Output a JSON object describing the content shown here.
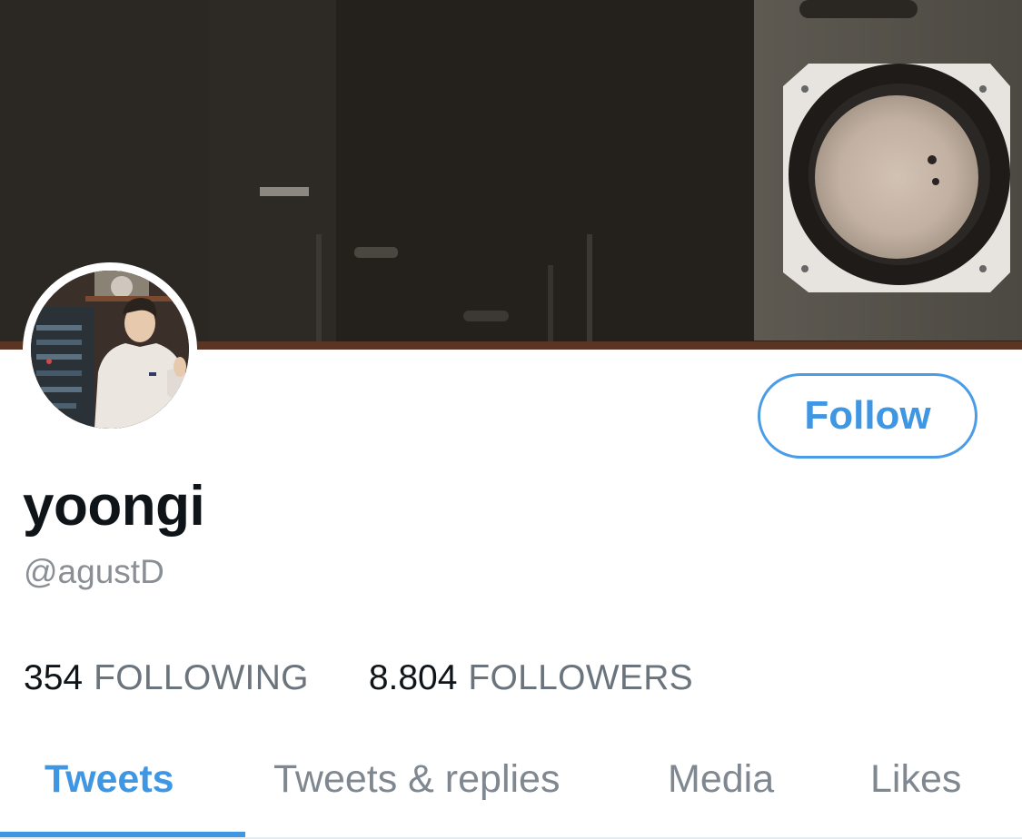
{
  "profile": {
    "display_name": "yoongi",
    "handle": "@agustD"
  },
  "actions": {
    "follow_label": "Follow"
  },
  "stats": {
    "following_count": "354",
    "following_label": "FOLLOWING",
    "followers_count": "8.804",
    "followers_label": "FOLLOWERS"
  },
  "tabs": [
    {
      "label": "Tweets",
      "active": true
    },
    {
      "label": "Tweets & replies",
      "active": false
    },
    {
      "label": "Media",
      "active": false
    },
    {
      "label": "Likes",
      "active": false
    }
  ],
  "colors": {
    "accent": "#3f96e2",
    "text_primary": "#0f1419",
    "text_secondary": "#8a8f96"
  }
}
